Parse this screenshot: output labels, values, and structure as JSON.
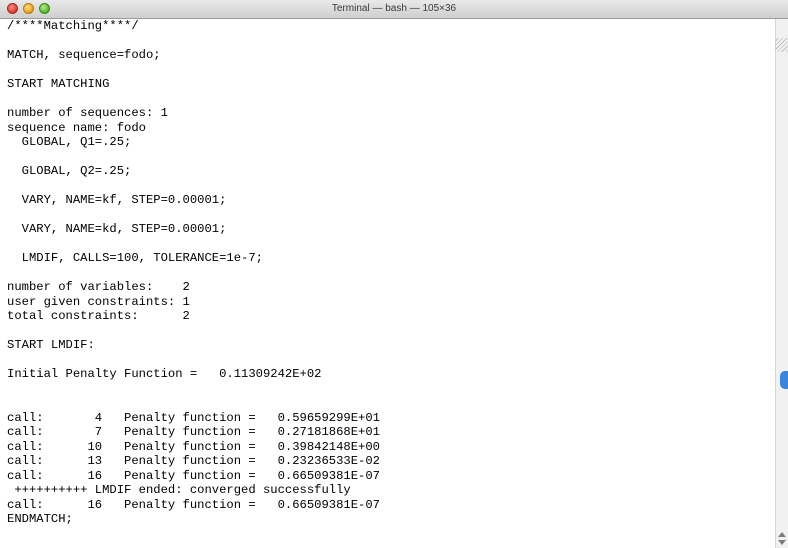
{
  "window": {
    "title": "Terminal — bash — 105×36"
  },
  "terminal": {
    "lines": [
      "/****Matching****/",
      "",
      "MATCH, sequence=fodo;",
      "",
      "START MATCHING",
      "",
      "number of sequences: 1",
      "sequence name: fodo",
      "  GLOBAL, Q1=.25;",
      "",
      "  GLOBAL, Q2=.25;",
      "",
      "  VARY, NAME=kf, STEP=0.00001;",
      "",
      "  VARY, NAME=kd, STEP=0.00001;",
      "",
      "  LMDIF, CALLS=100, TOLERANCE=1e-7;",
      "",
      "number of variables:    2",
      "user given constraints: 1",
      "total constraints:      2",
      "",
      "START LMDIF:",
      "",
      "Initial Penalty Function =   0.11309242E+02",
      "",
      "",
      "call:       4   Penalty function =   0.59659299E+01",
      "call:       7   Penalty function =   0.27181868E+01",
      "call:      10   Penalty function =   0.39842148E+00",
      "call:      13   Penalty function =   0.23236533E-02",
      "call:      16   Penalty function =   0.66509381E-07",
      " ++++++++++ LMDIF ended: converged successfully",
      "call:      16   Penalty function =   0.66509381E-07",
      "ENDMATCH;"
    ]
  },
  "colors": {
    "scroll_thumb": "#3c85df",
    "text": "#000000",
    "background": "#ffffff"
  }
}
